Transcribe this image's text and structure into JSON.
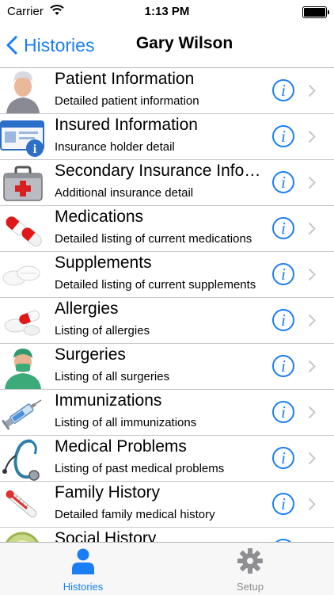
{
  "status_bar": {
    "carrier": "Carrier",
    "time": "1:13 PM"
  },
  "nav": {
    "back_label": "Histories",
    "title": "Gary Wilson"
  },
  "rows": [
    {
      "title": "Patient Information",
      "subtitle": "Detailed patient information",
      "icon": "patient-icon"
    },
    {
      "title": "Insured Information",
      "subtitle": "Insurance holder detail",
      "icon": "insurance-card-icon"
    },
    {
      "title": "Secondary Insurance Info…",
      "subtitle": "Additional insurance detail",
      "icon": "first-aid-kit-icon"
    },
    {
      "title": "Medications",
      "subtitle": "Detailed listing of current medications",
      "icon": "pills-icon"
    },
    {
      "title": "Supplements",
      "subtitle": "Detailed listing of current supplements",
      "icon": "supplement-tablets-icon"
    },
    {
      "title": "Allergies",
      "subtitle": "Listing of allergies",
      "icon": "allergy-pills-icon"
    },
    {
      "title": "Surgeries",
      "subtitle": "Listing of all surgeries",
      "icon": "surgeon-icon"
    },
    {
      "title": "Immunizations",
      "subtitle": "Listing of all immunizations",
      "icon": "syringe-icon"
    },
    {
      "title": "Medical Problems",
      "subtitle": "Listing of past medical problems",
      "icon": "stethoscope-icon"
    },
    {
      "title": "Family History",
      "subtitle": "Detailed family medical history",
      "icon": "thermometer-icon"
    },
    {
      "title": "Social History",
      "subtitle": "",
      "icon": "social-icon"
    }
  ],
  "info_glyph": "i",
  "tabs": [
    {
      "label": "Histories",
      "icon": "person-icon",
      "selected": true
    },
    {
      "label": "Setup",
      "icon": "gear-icon",
      "selected": false
    }
  ],
  "colors": {
    "accent": "#1a7ef5",
    "inactive": "#8e8e93",
    "separator": "#c8c7cc"
  }
}
